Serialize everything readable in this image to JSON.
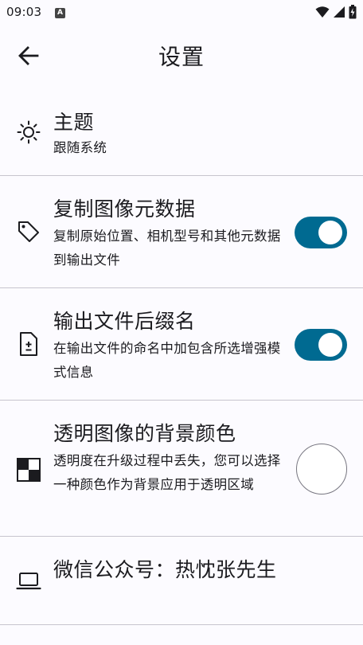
{
  "status_bar": {
    "time": "09:03",
    "app_icon_letter": "A"
  },
  "header": {
    "title": "设置"
  },
  "settings": [
    {
      "title": "主题",
      "description": "跟随系统",
      "icon": "sun-icon"
    },
    {
      "title": "复制图像元数据",
      "description": "复制原始位置、相机型号和其他元数据到输出文件",
      "icon": "tag-icon",
      "toggle_on": true
    },
    {
      "title": "输出文件后缀名",
      "description": "在输出文件的命名中加包含所选增强模式信息",
      "icon": "file-plus-minus-icon",
      "toggle_on": true
    },
    {
      "title": "透明图像的背景颜色",
      "description": "透明度在升级过程中丢失，您可以选择一种颜色作为背景应用于透明区域",
      "icon": "checkerboard-icon",
      "selected_color": "#FFFFFF"
    },
    {
      "title": "微信公众号：热忱张先生",
      "icon": "laptop-icon"
    }
  ],
  "colors": {
    "accent": "#006A91",
    "background": "#FCFBFF",
    "divider": "#C7C5CE"
  }
}
